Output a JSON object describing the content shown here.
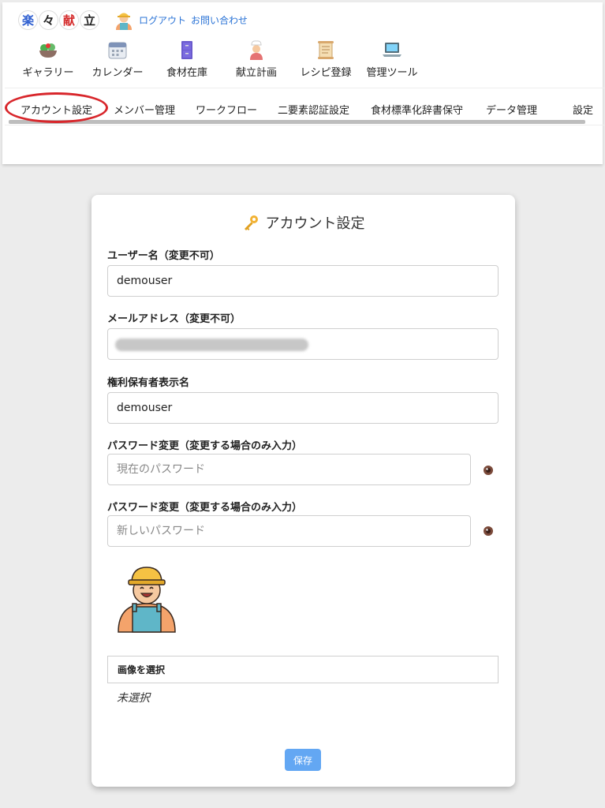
{
  "logo": {
    "chars": [
      "楽",
      "々",
      "献",
      "立"
    ]
  },
  "top_links": {
    "logout": "ログアウト",
    "contact": "お問い合わせ"
  },
  "nav": {
    "items": [
      {
        "label": "ギャラリー",
        "icon": "salad-bowl-icon"
      },
      {
        "label": "カレンダー",
        "icon": "calendar-icon"
      },
      {
        "label": "食材在庫",
        "icon": "storage-cabinet-icon"
      },
      {
        "label": "献立計画",
        "icon": "chef-icon"
      },
      {
        "label": "レシピ登録",
        "icon": "scroll-icon"
      },
      {
        "label": "管理ツール",
        "icon": "laptop-icon"
      }
    ]
  },
  "subnav": {
    "tabs": [
      {
        "label": "アカウント設定"
      },
      {
        "label": "メンバー管理"
      },
      {
        "label": "ワークフロー"
      },
      {
        "label": "二要素認証設定"
      },
      {
        "label": "食材標準化辞書保守"
      },
      {
        "label": "データ管理"
      },
      {
        "label": "設定"
      }
    ]
  },
  "form": {
    "title": "アカウント設定",
    "username": {
      "label": "ユーザー名（変更不可）",
      "value": "demouser"
    },
    "email": {
      "label": "メールアドレス（変更不可）",
      "value": ""
    },
    "display_name": {
      "label": "権利保有者表示名",
      "value": "demouser"
    },
    "current_password": {
      "label": "パスワード変更（変更する場合のみ入力）",
      "placeholder": "現在のパスワード"
    },
    "new_password": {
      "label": "パスワード変更（変更する場合のみ入力）",
      "placeholder": "新しいパスワード"
    },
    "file": {
      "button": "画像を選択",
      "status": "未選択"
    },
    "save_label": "保存"
  },
  "colors": {
    "accent": "#2a73d6",
    "save_button": "#63a7f3",
    "highlight_ring": "#d8262b"
  }
}
